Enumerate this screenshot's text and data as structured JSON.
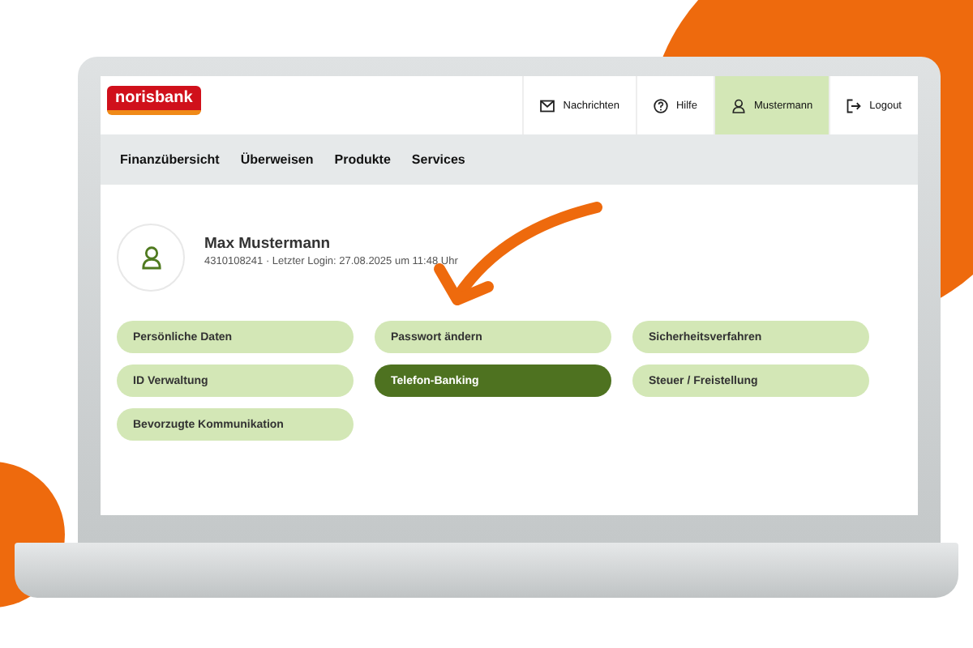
{
  "header": {
    "logo": "norisbank",
    "actions": [
      {
        "label": "Nachrichten",
        "kind": "mail",
        "selected": false
      },
      {
        "label": "Hilfe",
        "kind": "help",
        "selected": false
      },
      {
        "label": "Mustermann",
        "kind": "user",
        "selected": true
      },
      {
        "label": "Logout",
        "kind": "logout",
        "selected": false
      }
    ]
  },
  "nav": {
    "items": [
      "Finanzübersicht",
      "Überweisen",
      "Produkte",
      "Services"
    ]
  },
  "profile": {
    "name": "Max Mustermann",
    "details": "4310108241 · Letzter Login: 27.08.2025 um 11:48 Uhr"
  },
  "options": [
    {
      "label": "Persönliche Daten",
      "selected": false
    },
    {
      "label": "Passwort ändern",
      "selected": false
    },
    {
      "label": "Sicherheitsverfahren",
      "selected": false
    },
    {
      "label": "ID Verwaltung",
      "selected": false
    },
    {
      "label": "Telefon-Banking",
      "selected": true
    },
    {
      "label": "Steuer / Freistellung",
      "selected": false
    },
    {
      "label": "Bevorzugte Kommunikation",
      "selected": false
    }
  ]
}
